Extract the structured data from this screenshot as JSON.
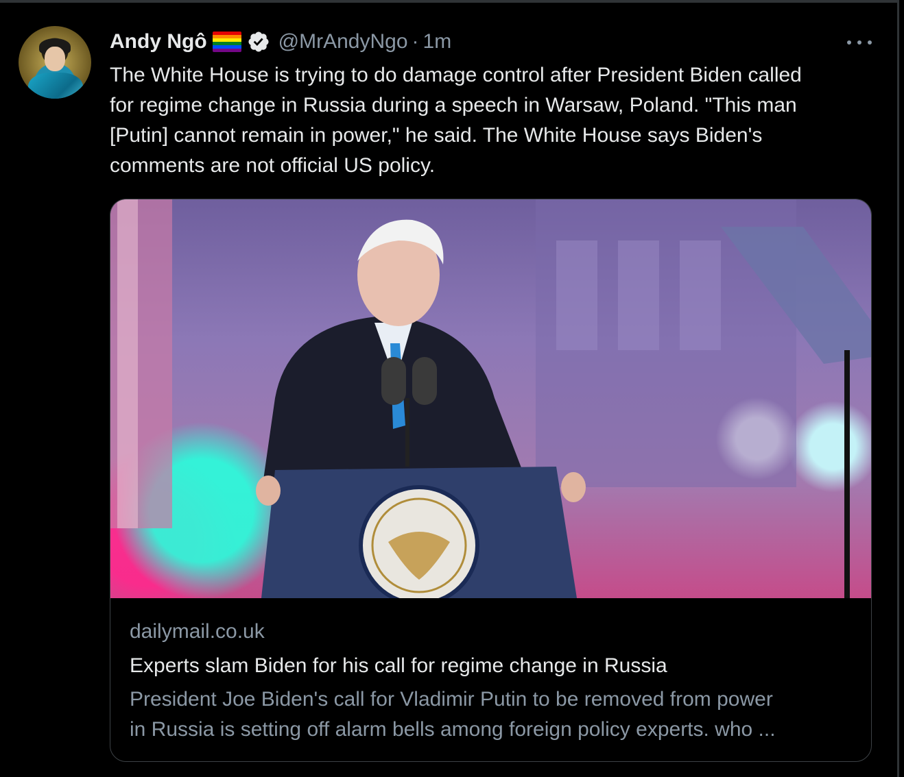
{
  "tweet": {
    "author_name": "Andy Ngô",
    "handle": "@MrAndyNgo",
    "separator": "·",
    "time": "1m",
    "text": "The White House is trying to do damage control after President Biden called\nfor regime change in Russia during a speech in Warsaw, Poland. \"This man\n[Putin] cannot remain in power,\" he said. The White House says Biden's\ncomments are not official US policy.",
    "icons": {
      "author_flag": "rainbow-flag-icon",
      "verified": "verified-badge-icon",
      "more": "more-options-icon"
    }
  },
  "card": {
    "domain": "dailymail.co.uk",
    "title": "Experts slam Biden for his call for regime change in Russia",
    "description": "President Joe Biden's call for Vladimir Putin to be removed from power\nin Russia is setting off alarm bells among foreign policy experts. who ..."
  },
  "colors": {
    "background": "#000000",
    "text_primary": "#e7e9ea",
    "text_secondary": "#8b98a5",
    "border": "#3d4246"
  }
}
